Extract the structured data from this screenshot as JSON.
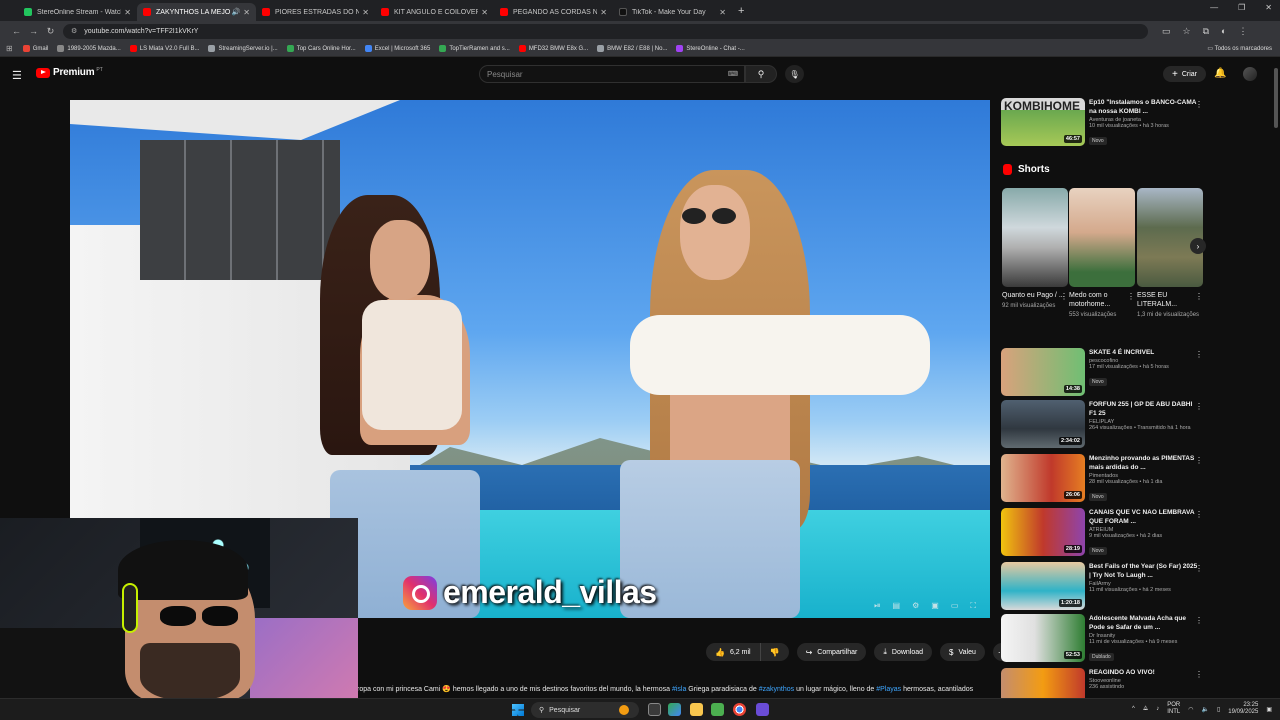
{
  "browser": {
    "tabs": [
      {
        "title": "StereOnline Stream - Watch Li...",
        "color": "#22c55e",
        "active": false
      },
      {
        "title": "ZAKYNTHOS LA MEJOR P...",
        "color": "#ff0000",
        "active": true,
        "audio": "🔊"
      },
      {
        "title": "PIORES ESTRADAS DO NOSSO...",
        "color": "#ff0000",
        "active": false
      },
      {
        "title": "KIT ANGULO E COILOVER INST...",
        "color": "#ff0000",
        "active": false
      },
      {
        "title": "PEGANDO AS CORDAS NA BAI...",
        "color": "#ff0000",
        "active": false
      },
      {
        "title": "TikTok - Make Your Day",
        "color": "#111111",
        "active": false
      }
    ],
    "new_tab": "+",
    "url": "youtube.com/watch?v=TFF2I1kVKrY",
    "bookmarks": [
      {
        "label": "Gmail",
        "color": "#ea4335"
      },
      {
        "label": "1989-2005 Mazda...",
        "color": "#888888"
      },
      {
        "label": "LS Miata V2.0 Full B...",
        "color": "#ff0000"
      },
      {
        "label": "StreamingServer.io |...",
        "color": "#9aa0a6"
      },
      {
        "label": "Top Cars Online Hor...",
        "color": "#34a853"
      },
      {
        "label": "Excel | Microsoft 365",
        "color": "#4285f4"
      },
      {
        "label": "TopTierRamen and s...",
        "color": "#34a853"
      },
      {
        "label": "MFD32 BMW E8x G...",
        "color": "#ff0000"
      },
      {
        "label": "BMW E82 / E88 | No...",
        "color": "#9aa0a6"
      },
      {
        "label": "StereOnline - Chat -...",
        "color": "#a142f4"
      }
    ],
    "all_bookmarks": "Todos os marcadores"
  },
  "youtube": {
    "logo_text": "Premium",
    "logo_region": "PT",
    "search_placeholder": "Pesquisar",
    "create_label": "Criar"
  },
  "video": {
    "watermark": "emerald_villas",
    "like_count": "6,2 mil",
    "share_label": "Compartilhar",
    "download_label": "Download",
    "thanks_label": "Valeu",
    "description": {
      "p1": "ropa con mi princesa Cami 😍 hemos llegado a uno de mis destinos favoritos del mundo, la hermosa ",
      "h1": "#isla",
      "p2": " Griega paradisiaca de ",
      "h2": "#zakynthos",
      "p3": " un lugar mágico, lleno de ",
      "h3": "#Playas",
      "p4": " hermosas, acantilados"
    }
  },
  "sidebar": {
    "top_video": {
      "title": "Ep10 \"Instalamos o BANCO-CAMA na nossa KOMBI ...",
      "channel": "Aventuras de joaneta",
      "meta": "10 mil visualizações • há 3 horas",
      "badge": "Novo",
      "duration": "46:57",
      "thumb_text": "KOMBIHOME"
    },
    "shorts_title": "Shorts",
    "shorts": [
      {
        "title": "Quanto eu Pago / ...",
        "views": "92 mil visualizações"
      },
      {
        "title": "Medo com o motorhome...",
        "views": "553 visualizações"
      },
      {
        "title": "ESSE EU LITERALM...",
        "views": "1,3 mi de visualizações"
      }
    ],
    "videos": [
      {
        "title": "SKATE 4 É INCRIVEL",
        "channel": "pescocofino",
        "meta": "17 mil visualizações • há 5 horas",
        "badge": "Novo",
        "duration": "14:38"
      },
      {
        "title": "FORFUN 255 | GP DE ABU DABHI F1 25",
        "channel": "FELIPLAY",
        "meta": "264 visualizações • Transmitido há 1 hora",
        "badge": "",
        "duration": "2:34:02"
      },
      {
        "title": "Menzinho provando as PIMENTAS mais ardidas do ...",
        "channel": "Pimentados",
        "meta": "28 mil visualizações • há 1 dia",
        "badge": "Novo",
        "duration": "26:06"
      },
      {
        "title": "CANAIS QUE VC NAO LEMBRAVA QUE FORAM ...",
        "channel": "ATREIUM",
        "meta": "9 mil visualizações • há 2 dias",
        "badge": "Novo",
        "duration": "28:19"
      },
      {
        "title": "Best Fails of the Year (So Far) 2025 | Try Not To Laugh ...",
        "channel": "FailArmy",
        "meta": "11 mil visualizações • há 2 meses",
        "badge": "",
        "duration": "1:20:18"
      },
      {
        "title": "Adolescente Malvada Acha que Pode se Safar de um ...",
        "channel": "Dr Insanity",
        "meta": "11 mi de visualizações • há 9 meses",
        "badge": "Dublado",
        "duration": "52:53"
      },
      {
        "title": "REAGINDO AO VIVO!",
        "channel": "Stooveonline",
        "meta": "236 assistindo",
        "badge": "",
        "duration": ""
      }
    ]
  },
  "taskbar": {
    "search_label": "Pesquisar",
    "lang_top": "POR",
    "lang_bottom": "INTL",
    "time": "23:25",
    "date": "19/09/2025"
  }
}
